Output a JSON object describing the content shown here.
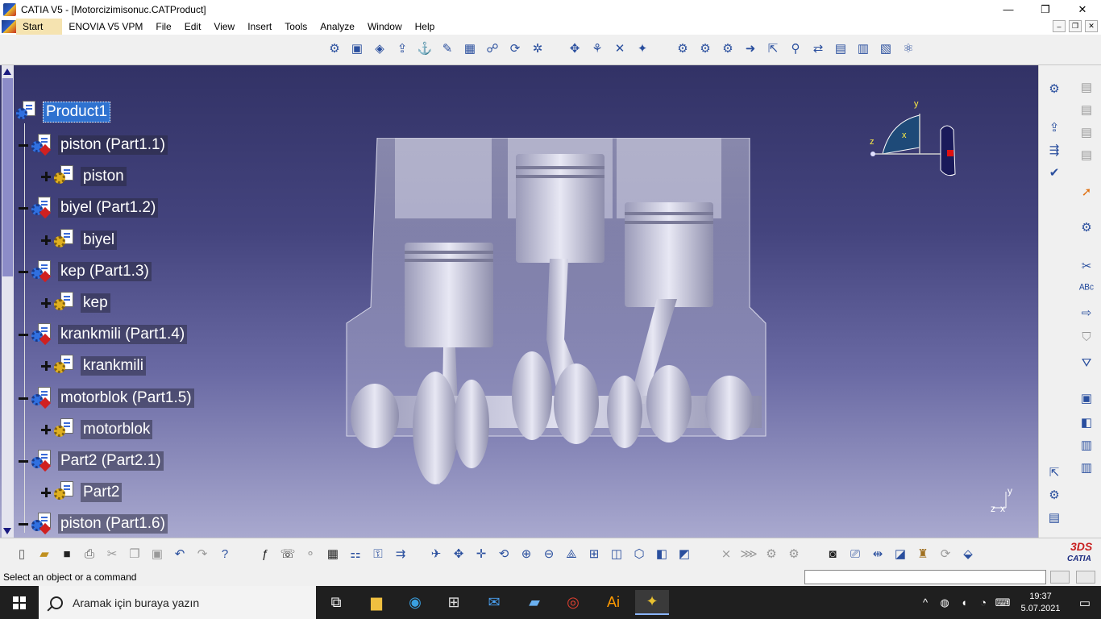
{
  "window": {
    "title": "CATIA V5 - [Motorcizimisonuc.CATProduct]",
    "minimize": "—",
    "maximize": "❐",
    "close": "✕"
  },
  "menu": {
    "items": [
      "Start",
      "ENOVIA V5 VPM",
      "File",
      "Edit",
      "View",
      "Insert",
      "Tools",
      "Analyze",
      "Window",
      "Help"
    ],
    "mdi_min": "–",
    "mdi_restore": "❐",
    "mdi_close": "✕"
  },
  "tree": {
    "root": "Product1",
    "nodes": [
      {
        "label": "piston (Part1.1)",
        "child": "piston"
      },
      {
        "label": "biyel (Part1.2)",
        "child": "biyel"
      },
      {
        "label": "kep (Part1.3)",
        "child": "kep"
      },
      {
        "label": "krankmili (Part1.4)",
        "child": "krankmili"
      },
      {
        "label": "motorblok (Part1.5)",
        "child": "motorblok"
      },
      {
        "label": "Part2 (Part2.1)",
        "child": "Part2"
      },
      {
        "label": "piston (Part1.6)",
        "child": ""
      }
    ]
  },
  "compass": {
    "x_label": "x",
    "y_label": "y",
    "z_label": "z"
  },
  "axis_triad": {
    "y": "y",
    "z": "z",
    "x": "x"
  },
  "branding": {
    "ds": "3DS",
    "name": "CATIA"
  },
  "status": {
    "text": "Select an object or a command",
    "command_value": ""
  },
  "taskbar": {
    "search_placeholder": "Aramak için buraya yazın",
    "time": "19:37",
    "date": "5.07.2021"
  },
  "colors": {
    "viewport_top": "#323266",
    "viewport_bottom": "#a9a9cf",
    "selection": "#2f72d0",
    "tree_text": "#ffffff"
  }
}
